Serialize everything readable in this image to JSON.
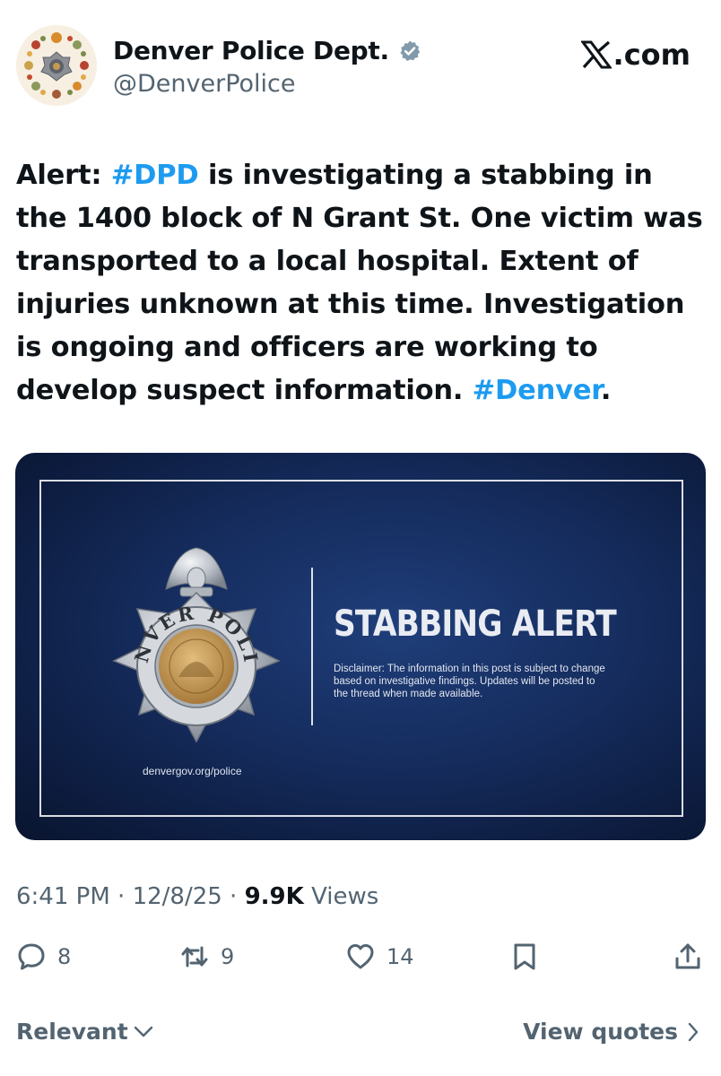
{
  "author": {
    "display_name": "Denver Police Dept.",
    "handle": "@DenverPolice",
    "verified_icon": "verified-badge-icon",
    "avatar_icon": "police-badge-wreath-avatar"
  },
  "source_site": {
    "label": ".com",
    "logo_icon": "x-logo-icon"
  },
  "post": {
    "parts": [
      {
        "text": "Alert: ",
        "hashtag": false
      },
      {
        "text": "#DPD",
        "hashtag": true
      },
      {
        "text": " is investigating a stabbing in the 1400 block of N Grant St. One victim was transported to a local hospital. Extent of injuries unknown at this time. Investigation is ongoing and officers are working to develop suspect information. ",
        "hashtag": false
      },
      {
        "text": "#Denver",
        "hashtag": true
      },
      {
        "text": ".",
        "hashtag": false
      }
    ]
  },
  "media": {
    "badge_text_top": "DENVER POLICE",
    "title": "STABBING ALERT",
    "disclaimer": "Disclaimer: The information in this post is subject to change based on investigative findings. Updates will be posted to the thread when made available.",
    "url": "denvergov.org/police"
  },
  "meta": {
    "time": "6:41 PM",
    "date": "12/8/25",
    "views_count": "9.9K",
    "views_label": "Views"
  },
  "actions": {
    "replies": "8",
    "reposts": "9",
    "likes": "14"
  },
  "footer": {
    "sort_label": "Relevant",
    "view_quotes_label": "View quotes"
  },
  "colors": {
    "text": "#0f1419",
    "secondary": "#536471",
    "hashtag": "#1d9bf0",
    "verified": "#829aab",
    "media_bg": "#152c5d"
  }
}
